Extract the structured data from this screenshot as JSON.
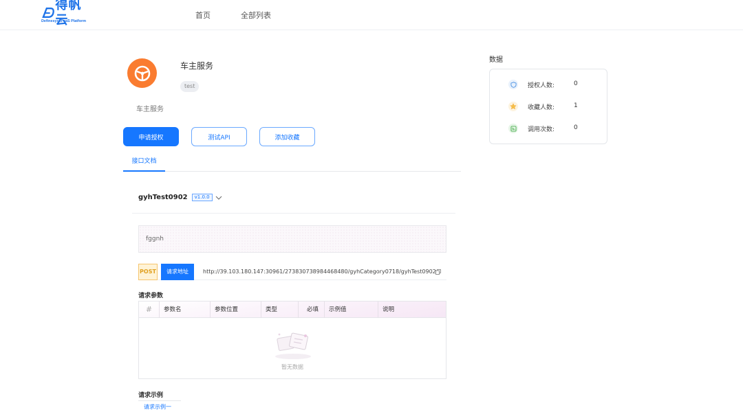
{
  "header": {
    "logo_text": "得帆云",
    "logo_sub": "Definesys iPaaS Platform",
    "nav": [
      "首页",
      "全部列表"
    ]
  },
  "service": {
    "title": "车主服务",
    "tag": "test",
    "description": "车主服务",
    "icon": "steering-wheel-icon",
    "icon_color": "#fa7c30"
  },
  "actions": {
    "apply": "申请授权",
    "test": "测试API",
    "favorite": "添加收藏"
  },
  "tabs": [
    "接口文档"
  ],
  "api": {
    "name": "gyhTest0902",
    "version": "v1.0.0",
    "description": "fggnh",
    "method": "POST",
    "url_label": "请求地址",
    "url": "http://39.103.180.147:30961/273830738984468480/gyhCategory0718/gyhTest0902"
  },
  "params": {
    "title": "请求参数",
    "columns": [
      "#",
      "参数名",
      "参数位置",
      "类型",
      "必填",
      "示例值",
      "说明"
    ],
    "rows": [],
    "empty_text": "暂无数据"
  },
  "example": {
    "title": "请求示例",
    "tab": "请求示例一"
  },
  "stats": {
    "title": "数据",
    "items": [
      {
        "label": "授权人数:",
        "value": "0",
        "icon": "shield-icon",
        "color": "#4a90e2"
      },
      {
        "label": "收藏人数:",
        "value": "1",
        "icon": "star-icon",
        "color": "#f5a623"
      },
      {
        "label": "调用次数:",
        "value": "0",
        "icon": "calls-icon",
        "color": "#4caf50"
      }
    ]
  },
  "colors": {
    "primary": "#1677ff",
    "post": "#e0a020"
  }
}
